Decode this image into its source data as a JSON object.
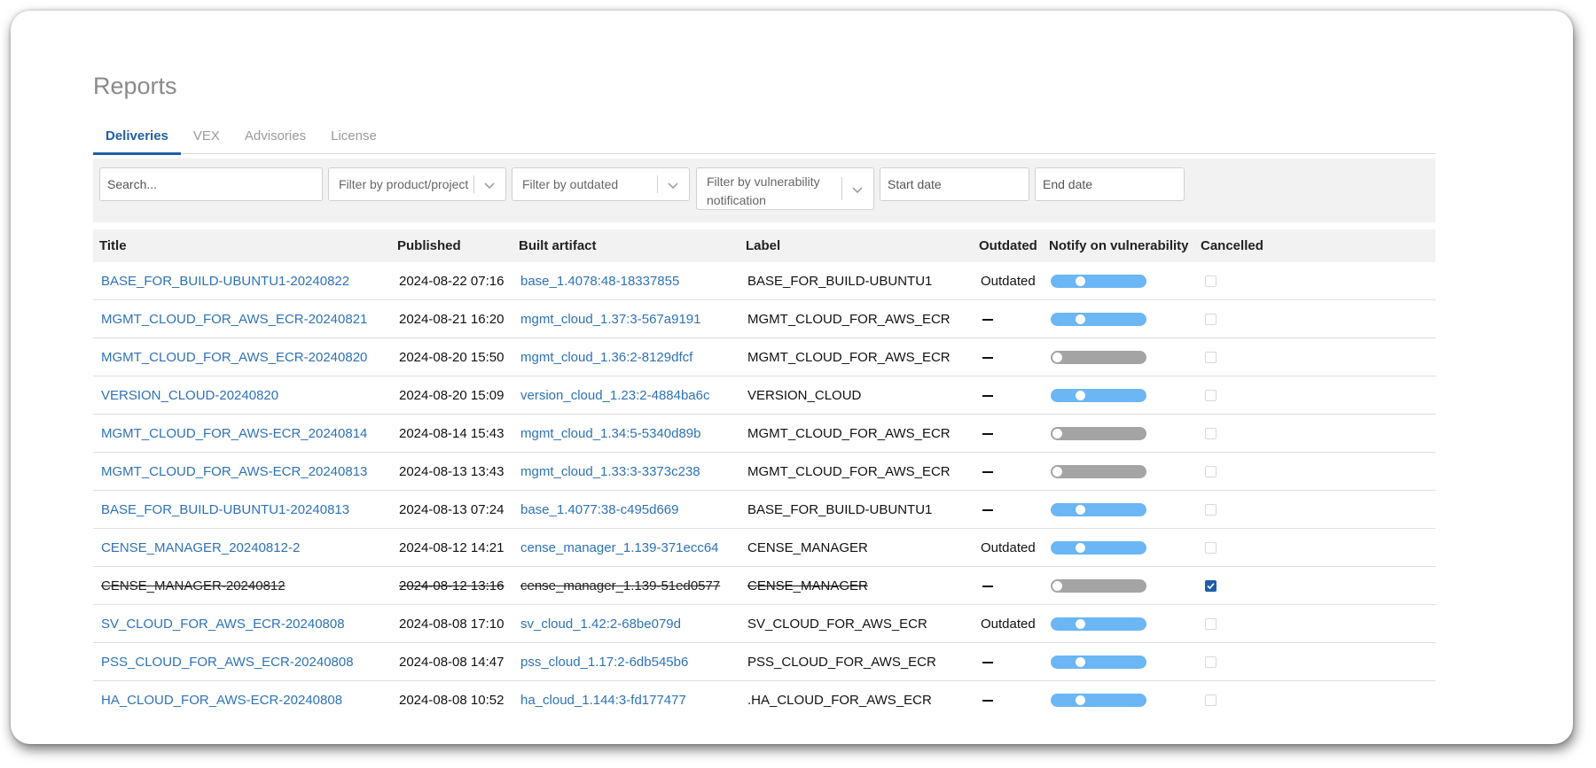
{
  "page": {
    "title": "Reports"
  },
  "tabs": [
    {
      "label": "Deliveries",
      "active": true
    },
    {
      "label": "VEX",
      "active": false
    },
    {
      "label": "Advisories",
      "active": false
    },
    {
      "label": "License",
      "active": false
    }
  ],
  "filters": {
    "search_placeholder": "Search...",
    "product_placeholder": "Filter by product/project",
    "outdated_placeholder": "Filter by outdated",
    "vuln_placeholder": "Filter by vulnerability notification",
    "start_date_placeholder": "Start date",
    "end_date_placeholder": "End date"
  },
  "table": {
    "columns": [
      "Title",
      "Published",
      "Built artifact",
      "Label",
      "Outdated",
      "Notify on vulnerability",
      "Cancelled"
    ],
    "rows": [
      {
        "title": "BASE_FOR_BUILD-UBUNTU1-20240822",
        "published": "2024-08-22 07:16",
        "artifact": "base_1.4078:48-18337855",
        "label": "BASE_FOR_BUILD-UBUNTU1",
        "outdated": "Outdated",
        "notify": true,
        "cancelled": false
      },
      {
        "title": "MGMT_CLOUD_FOR_AWS_ECR-20240821",
        "published": "2024-08-21 16:20",
        "artifact": "mgmt_cloud_1.37:3-567a9191",
        "label": "MGMT_CLOUD_FOR_AWS_ECR",
        "outdated": "",
        "notify": true,
        "cancelled": false
      },
      {
        "title": "MGMT_CLOUD_FOR_AWS_ECR-20240820",
        "published": "2024-08-20 15:50",
        "artifact": "mgmt_cloud_1.36:2-8129dfcf",
        "label": "MGMT_CLOUD_FOR_AWS_ECR",
        "outdated": "",
        "notify": false,
        "cancelled": false
      },
      {
        "title": "VERSION_CLOUD-20240820",
        "published": "2024-08-20 15:09",
        "artifact": "version_cloud_1.23:2-4884ba6c",
        "label": "VERSION_CLOUD",
        "outdated": "",
        "notify": true,
        "cancelled": false
      },
      {
        "title": "MGMT_CLOUD_FOR_AWS-ECR_20240814",
        "published": "2024-08-14 15:43",
        "artifact": "mgmt_cloud_1.34:5-5340d89b",
        "label": "MGMT_CLOUD_FOR_AWS_ECR",
        "outdated": "",
        "notify": false,
        "cancelled": false
      },
      {
        "title": "MGMT_CLOUD_FOR_AWS-ECR_20240813",
        "published": "2024-08-13 13:43",
        "artifact": "mgmt_cloud_1.33:3-3373c238",
        "label": "MGMT_CLOUD_FOR_AWS_ECR",
        "outdated": "",
        "notify": false,
        "cancelled": false
      },
      {
        "title": "BASE_FOR_BUILD-UBUNTU1-20240813",
        "published": "2024-08-13 07:24",
        "artifact": "base_1.4077:38-c495d669",
        "label": "BASE_FOR_BUILD-UBUNTU1",
        "outdated": "",
        "notify": true,
        "cancelled": false
      },
      {
        "title": "CENSE_MANAGER_20240812-2",
        "published": "2024-08-12 14:21",
        "artifact": "cense_manager_1.139-371ecc64",
        "label": "CENSE_MANAGER",
        "outdated": "Outdated",
        "notify": true,
        "cancelled": false
      },
      {
        "title": "CENSE_MANAGER-20240812",
        "published": "2024-08-12 13:16",
        "artifact": "cense_manager_1.139-51ed0577",
        "label": "CENSE_MANAGER",
        "outdated": "",
        "notify": false,
        "cancelled": true
      },
      {
        "title": "SV_CLOUD_FOR_AWS_ECR-20240808",
        "published": "2024-08-08 17:10",
        "artifact": "sv_cloud_1.42:2-68be079d",
        "label": "SV_CLOUD_FOR_AWS_ECR",
        "outdated": "Outdated",
        "notify": true,
        "cancelled": false
      },
      {
        "title": "PSS_CLOUD_FOR_AWS_ECR-20240808",
        "published": "2024-08-08 14:47",
        "artifact": "pss_cloud_1.17:2-6db545b6",
        "label": "PSS_CLOUD_FOR_AWS_ECR",
        "outdated": "",
        "notify": true,
        "cancelled": false
      },
      {
        "title": "HA_CLOUD_FOR_AWS-ECR-20240808",
        "published": "2024-08-08 10:52",
        "artifact": "ha_cloud_1.144:3-fd177477",
        "label": ".HA_CLOUD_FOR_AWS_ECR",
        "outdated": "",
        "notify": true,
        "cancelled": false
      }
    ]
  },
  "colors": {
    "accent": "#1f5fa8",
    "link": "#2e72b6",
    "toggle_on": "#6bb6f4",
    "toggle_off": "#a4a4a4"
  }
}
